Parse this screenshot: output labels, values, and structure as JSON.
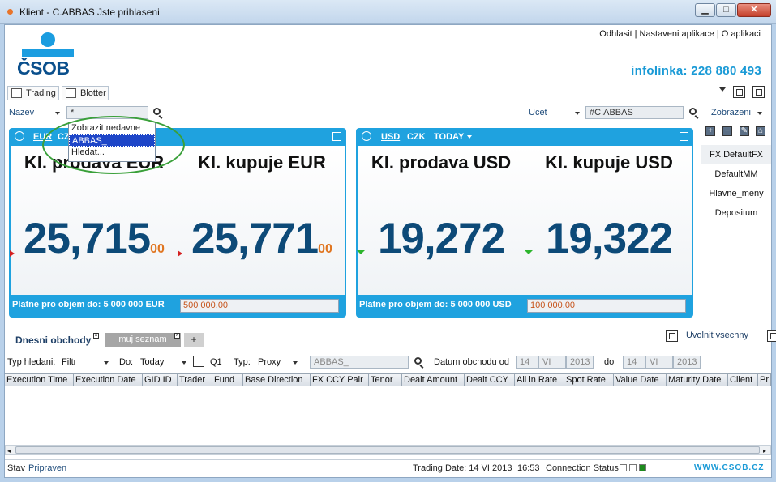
{
  "window": {
    "title": "Klient - C.ABBAS Jste prihlaseni",
    "min": "▁",
    "max": "□",
    "close": "✕"
  },
  "header": {
    "links": [
      "Odhlasit",
      "Nastaveni aplikace",
      "O aplikaci"
    ],
    "logo_text": "ČSOB",
    "infolinka": "infolinka: 228 880 493"
  },
  "toolbar": {
    "tab_trading": "Trading",
    "tab_blotter": "Blotter"
  },
  "filter": {
    "nazev_label": "Nazev",
    "nazev_value": "*",
    "ucet_label": "Ucet",
    "ucet_value": "#C.ABBAS",
    "zobrazeni_label": "Zobrazeni"
  },
  "popup": {
    "items": [
      "Zobrazit nedavne",
      "ABBAS_",
      "Hledat..."
    ]
  },
  "tiles": [
    {
      "pair_base": "EUR",
      "pair_quote": "CZK",
      "sell_label": "Kl. prodava EUR",
      "buy_label": "Kl. kupuje EUR",
      "sell_big": "25,715",
      "sell_pip": "00",
      "buy_big": "25,771",
      "buy_pip": "00",
      "footer": "Platne pro objem do: 5 000 000 EUR",
      "volume": "500 000,00"
    },
    {
      "pair_base": "USD",
      "pair_quote": "CZK",
      "tenor": "TODAY",
      "sell_label": "Kl. prodava USD",
      "buy_label": "Kl. kupuje USD",
      "sell_big": "19,272",
      "buy_big": "19,322",
      "footer": "Platne pro objem do: 5 000 000 USD",
      "volume": "100 000,00"
    }
  ],
  "sidebar": {
    "items": [
      "FX.DefaultFX",
      "DefaultMM",
      "Hlavne_meny",
      "Depositum"
    ]
  },
  "blotter": {
    "tab_main": "Dnesni obchody",
    "tab_list": "muj seznam",
    "tab_add": "+",
    "release_all": "Uvolnit vsechny",
    "search_type_label": "Typ hledani:",
    "search_type_value": "Filtr",
    "do_label": "Do:",
    "do_value": "Today",
    "q1": "Q1",
    "typ_label": "Typ:",
    "typ_value": "Proxy",
    "search_value": "ABBAS_",
    "date_from_label": "Datum obchodu od",
    "date_from": [
      "14",
      "VI",
      "2013"
    ],
    "date_to_label": "do",
    "date_to": [
      "14",
      "VI",
      "2013"
    ],
    "columns": [
      "Execution Time",
      "Execution Date",
      "GID ID",
      "Trader",
      "Fund",
      "Base Direction",
      "FX CCY Pair",
      "Tenor",
      "Dealt Amount",
      "Dealt CCY",
      "All in Rate",
      "Spot Rate",
      "Value Date",
      "Maturity Date",
      "Client",
      "Pr"
    ]
  },
  "status": {
    "stav_label": "Stav",
    "stav_value": "Pripraven",
    "trading_date": "Trading Date: 14 VI 2013",
    "time": "16:53",
    "connection": "Connection Status",
    "website": "www.csob.cz"
  }
}
